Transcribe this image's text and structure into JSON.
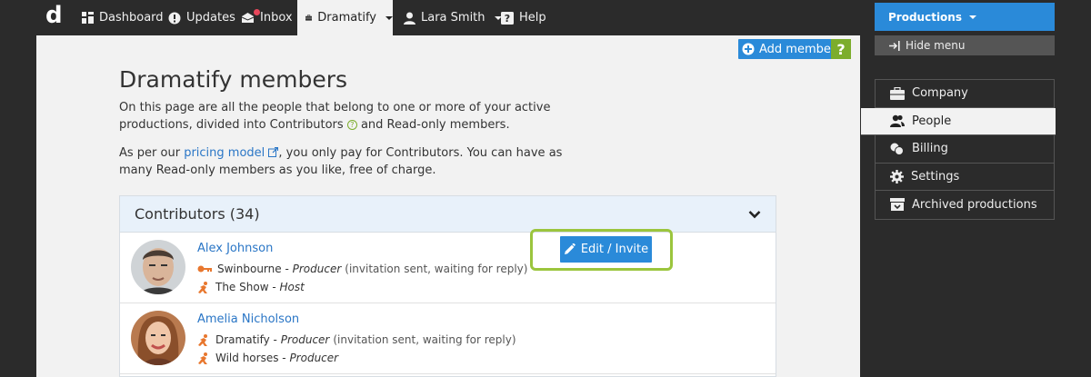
{
  "nav": {
    "logo": "d",
    "items": [
      {
        "label": "Dashboard",
        "icon": "dashboard-icon"
      },
      {
        "label": "Updates",
        "icon": "updates-icon"
      },
      {
        "label": "Inbox",
        "icon": "inbox-icon"
      },
      {
        "label": "Dramatify",
        "icon": "briefcase-icon"
      },
      {
        "label": "Lara Smith",
        "icon": "user-icon"
      },
      {
        "label": "Help",
        "icon": "help-icon"
      }
    ]
  },
  "main": {
    "add_member_label": "Add member",
    "help_label": "?",
    "title": "Dramatify members",
    "intro_a": "On this page are all the people that belong to one or more of your active productions, divided into Contributors",
    "intro_b": " and Read-only members.",
    "pricing_a": "As per our ",
    "pricing_link": "pricing model",
    "pricing_b": ", you only pay for Contributors. You can have as many Read-only members as you like, free of charge.",
    "panel_title": "Contributors (34)",
    "edit_label": "Edit / Invite",
    "members": [
      {
        "name": "Alex Johnson",
        "roles": [
          {
            "production": "Swinbourne",
            "role": "Producer",
            "note": "(invitation sent, waiting for reply)",
            "icon": "key-icon"
          },
          {
            "production": "The Show",
            "role": "Host",
            "note": "",
            "icon": "person-run-icon"
          }
        ]
      },
      {
        "name": "Amelia Nicholson",
        "roles": [
          {
            "production": "Dramatify",
            "role": "Producer",
            "note": "(invitation sent, waiting for reply)",
            "icon": "person-run-icon"
          },
          {
            "production": "Wild horses",
            "role": "Producer",
            "note": "",
            "icon": "person-run-icon"
          }
        ]
      }
    ]
  },
  "sidebar": {
    "productions_label": "Productions",
    "hide_menu_label": "Hide menu",
    "items": [
      {
        "label": "Company",
        "icon": "briefcase-icon"
      },
      {
        "label": "People",
        "icon": "people-icon"
      },
      {
        "label": "Billing",
        "icon": "coins-icon"
      },
      {
        "label": "Settings",
        "icon": "gear-icon"
      },
      {
        "label": "Archived productions",
        "icon": "archive-icon"
      }
    ]
  },
  "colors": {
    "accent": "#2a8ad9",
    "green": "#7cad2c",
    "orange_role": "#e8772e"
  }
}
